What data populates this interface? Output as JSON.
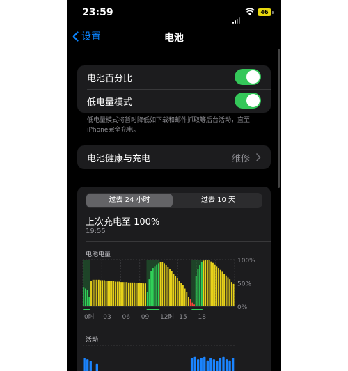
{
  "status_bar": {
    "time": "23:59",
    "battery_level": "46"
  },
  "nav": {
    "back_label": "设置",
    "title": "电池"
  },
  "settings": {
    "battery_percentage_label": "电池百分比",
    "battery_percentage_on": true,
    "low_power_label": "低电量模式",
    "low_power_on": true,
    "low_power_note": "低电量模式将暂时降低如下载和邮件抓取等后台活动，直至iPhone完全充电。",
    "health_label": "电池健康与充电",
    "health_value": "维修"
  },
  "usage": {
    "tabs": [
      {
        "label": "过去 24 小时",
        "active": true
      },
      {
        "label": "过去 10 天",
        "active": false
      }
    ],
    "last_charge_label": "上次充电至 100%",
    "last_charge_time": "19:55",
    "battery_chart_title": "电池电量",
    "activity_title": "活动"
  },
  "chart_data": [
    {
      "type": "bar",
      "title": "电池电量",
      "x_ticks": [
        "0时",
        "03",
        "06",
        "09",
        "12时",
        "15",
        "18"
      ],
      "y_ticks": [
        "100%",
        "50%",
        "0%"
      ],
      "ylim": [
        0,
        100
      ],
      "colors": {
        "normal": "#e8d21a",
        "charging": "#30d158",
        "low": "#ff453a",
        "charging_shade": "#1f5f2e"
      },
      "values": [
        40,
        38,
        35,
        20,
        55,
        57,
        57,
        57,
        57,
        56,
        56,
        56,
        55,
        55,
        55,
        54,
        54,
        53,
        53,
        53,
        52,
        52,
        52,
        52,
        51,
        51,
        51,
        51,
        50,
        50,
        50,
        50,
        49,
        49,
        30,
        58,
        75,
        82,
        86,
        90,
        92,
        94,
        95,
        92,
        88,
        85,
        80,
        76,
        70,
        65,
        60,
        55,
        50,
        45,
        38,
        30,
        20,
        15,
        8,
        4,
        65,
        80,
        88,
        95,
        98,
        100,
        100,
        99,
        96,
        93,
        90,
        86,
        82,
        78,
        74,
        70,
        66,
        62,
        58,
        52,
        48
      ],
      "charging_segments": [
        [
          0,
          3
        ],
        [
          34,
          40
        ],
        [
          58,
          63
        ]
      ],
      "low_indices": [
        57,
        58,
        59
      ]
    },
    {
      "type": "bar",
      "title": "活动",
      "values": [
        35,
        30,
        28,
        0,
        22,
        0,
        0,
        0,
        0,
        0,
        0,
        0,
        0,
        0,
        0,
        0,
        0,
        0,
        0,
        0,
        0,
        0,
        0,
        0,
        0,
        0,
        0,
        0,
        0,
        0,
        0,
        0,
        0,
        0,
        0,
        0,
        0,
        0,
        0,
        0,
        0,
        0,
        0,
        0,
        0,
        0,
        0,
        0,
        0,
        0,
        0,
        0,
        0,
        0,
        0,
        0,
        0,
        0,
        0,
        0,
        0,
        0,
        0,
        0,
        0,
        0,
        0,
        0,
        0,
        0,
        0,
        0,
        0,
        0,
        0,
        0,
        0,
        0,
        0,
        0,
        0
      ],
      "colors": {
        "bar": "#1a84ff"
      }
    }
  ]
}
